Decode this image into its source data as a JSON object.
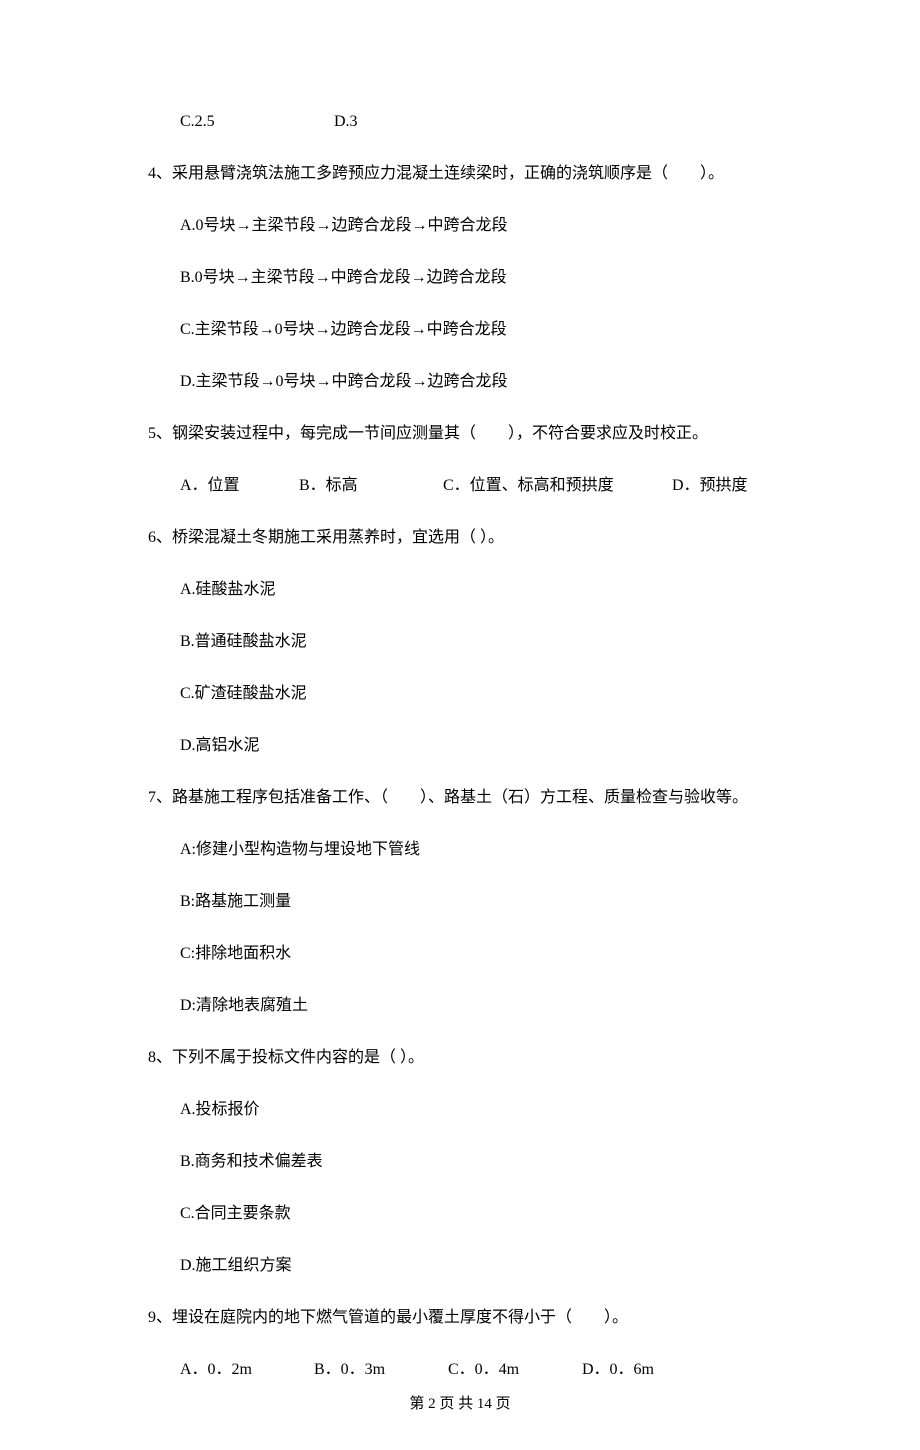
{
  "q3": {
    "optC": "C.2.5",
    "optD": "D.3"
  },
  "q4": {
    "stem": "4、采用悬臂浇筑法施工多跨预应力混凝土连续梁时，正确的浇筑顺序是（　　）。",
    "A": "A.0号块→主梁节段→边跨合龙段→中跨合龙段",
    "B": "B.0号块→主梁节段→中跨合龙段→边跨合龙段",
    "C": "C.主梁节段→0号块→边跨合龙段→中跨合龙段",
    "D": "D.主梁节段→0号块→中跨合龙段→边跨合龙段"
  },
  "q5": {
    "stem": "5、钢梁安装过程中，每完成一节间应测量其（　　），不符合要求应及时校正。",
    "A": "A．位置",
    "B": "B．标高",
    "C": "C．位置、标高和预拱度",
    "D": "D．预拱度"
  },
  "q6": {
    "stem": "6、桥梁混凝土冬期施工采用蒸养时，宜选用（  ）。",
    "A": "A.硅酸盐水泥",
    "B": "B.普通硅酸盐水泥",
    "C": "C.矿渣硅酸盐水泥",
    "D": "D.高铝水泥"
  },
  "q7": {
    "stem": "7、路基施工程序包括准备工作、（　　）、路基土（石）方工程、质量检查与验收等。",
    "A": "A:修建小型构造物与埋设地下管线",
    "B": "B:路基施工测量",
    "C": "C:排除地面积水",
    "D": "D:清除地表腐殖土"
  },
  "q8": {
    "stem": "8、下列不属于投标文件内容的是（  ）。",
    "A": "A.投标报价",
    "B": "B.商务和技术偏差表",
    "C": "C.合同主要条款",
    "D": "D.施工组织方案"
  },
  "q9": {
    "stem": "9、埋设在庭院内的地下燃气管道的最小覆土厚度不得小于（　　）。",
    "A": "A．0．2m",
    "B": "B．0．3m",
    "C": "C．0．4m",
    "D": "D．0．6m"
  },
  "footer": "第 2 页 共 14 页"
}
